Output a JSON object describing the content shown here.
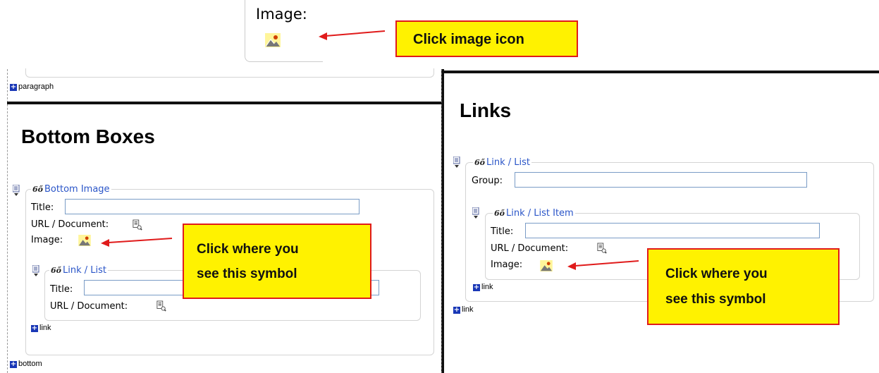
{
  "top_snippet": {
    "image_label": "Image:",
    "icon": "image-icon"
  },
  "callouts": {
    "top": "Click image icon",
    "left_line1": "Click where you",
    "left_line2": "see this symbol",
    "right_line1": "Click where you",
    "right_line2": "see this symbol"
  },
  "left_panel": {
    "paragraph_label": "paragraph",
    "heading": "Bottom Boxes",
    "bottom_image": {
      "legend": "Bottom Image",
      "title_label": "Title:",
      "title_value": "",
      "url_label": "URL / Document:",
      "image_label": "Image:"
    },
    "link_list": {
      "legend": "Link / List",
      "title_label": "Title:",
      "title_value": "",
      "url_label": "URL / Document:"
    },
    "link_label": "link",
    "bottom_label": "bottom"
  },
  "right_panel": {
    "heading": "Links",
    "link_list": {
      "legend": "Link / List",
      "group_label": "Group:",
      "group_value": ""
    },
    "link_list_item": {
      "legend": "Link / List Item",
      "title_label": "Title:",
      "title_value": "",
      "url_label": "URL / Document:",
      "image_label": "Image:"
    },
    "inner_link_label": "link",
    "outer_link_label": "link"
  },
  "colors": {
    "callout_bg": "#fff200",
    "callout_border": "#e01b1b",
    "arrow": "#e01b1b",
    "legend": "#2a55c8",
    "plus": "#1937b6"
  }
}
